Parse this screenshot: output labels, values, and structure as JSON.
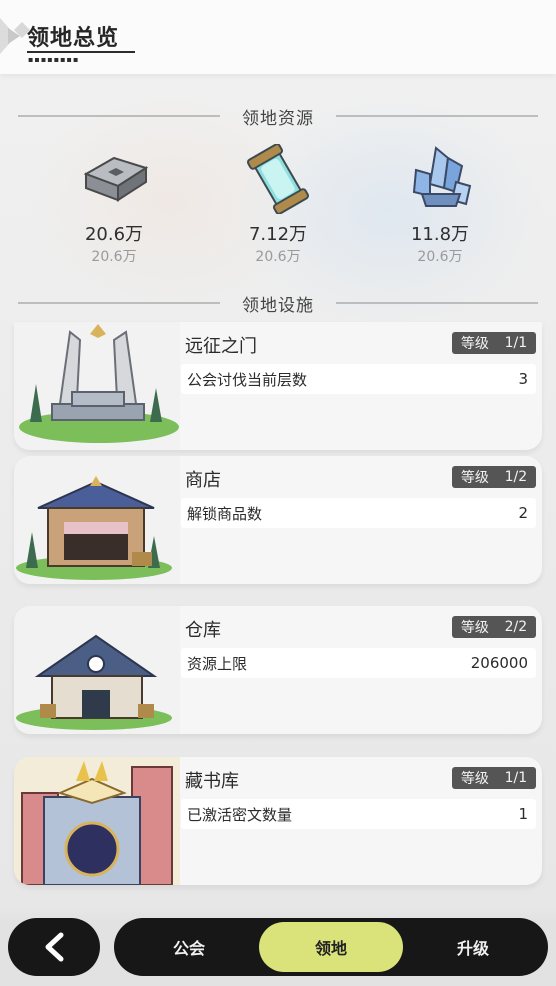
{
  "header": {
    "title": "领地总览"
  },
  "resources_section": {
    "title": "领地资源"
  },
  "resources": [
    {
      "icon": "iron-ingot-icon",
      "value": "20.6万",
      "cap": "20.6万"
    },
    {
      "icon": "crystal-scroll-icon",
      "value": "7.12万",
      "cap": "20.6万"
    },
    {
      "icon": "blue-crystal-icon",
      "value": "11.8万",
      "cap": "20.6万"
    }
  ],
  "facilities_section": {
    "title": "领地设施"
  },
  "facilities": [
    {
      "name": "远征之门",
      "level_label": "等级",
      "level": "1/1",
      "stat_label": "公会讨伐当前层数",
      "stat_value": "3"
    },
    {
      "name": "商店",
      "level_label": "等级",
      "level": "1/2",
      "stat_label": "解锁商品数",
      "stat_value": "2"
    },
    {
      "name": "仓库",
      "level_label": "等级",
      "level": "2/2",
      "stat_label": "资源上限",
      "stat_value": "206000"
    },
    {
      "name": "藏书库",
      "level_label": "等级",
      "level": "1/1",
      "stat_label": "已激活密文数量",
      "stat_value": "1"
    }
  ],
  "nav": {
    "back_icon": "chevron-left-icon",
    "tabs": [
      {
        "label": "公会",
        "active": false
      },
      {
        "label": "领地",
        "active": true
      },
      {
        "label": "升级",
        "active": false
      }
    ]
  },
  "colors": {
    "accent": "#d9e37a",
    "dark": "#171717",
    "level_badge": "#555555"
  }
}
